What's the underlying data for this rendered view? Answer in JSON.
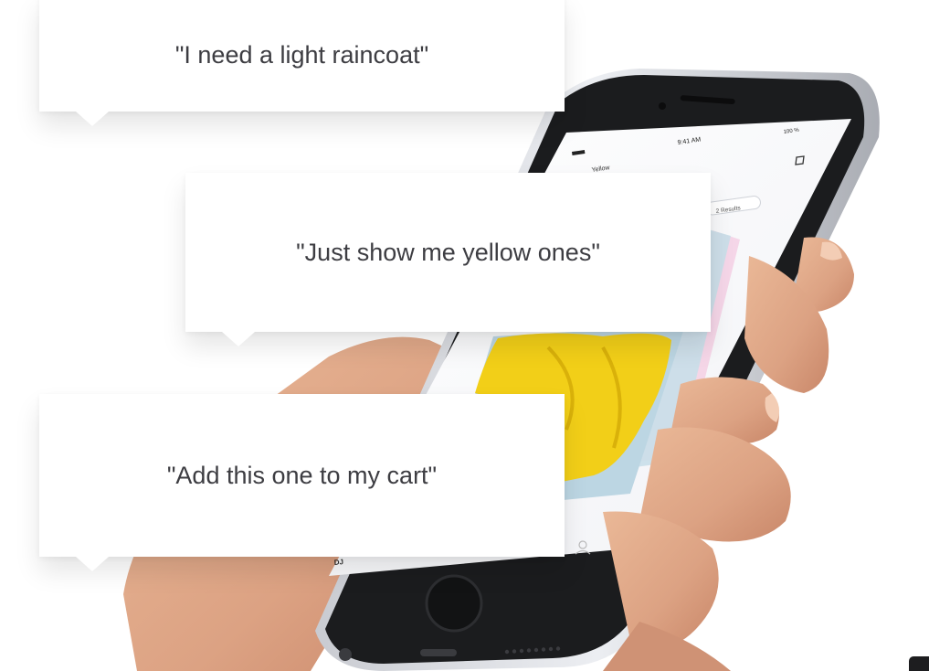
{
  "bubbles": {
    "first": "\"I need a light raincoat\"",
    "second": "\"Just show me yellow ones\"",
    "third": "\"Add this one to my cart\""
  },
  "phone": {
    "status_time": "9:41 AM",
    "status_battery": "100 %",
    "search_term": "Yellow",
    "results_label": "2 Results",
    "bottom_nav_label": "DJ",
    "product_color": "#f2cf18",
    "body_color": "#d9dadf",
    "bezel_color": "#1b1c1e"
  },
  "colors": {
    "bubble_text": "#3d3d42",
    "skin": "#e2ab8c",
    "background": "#ffffff"
  }
}
